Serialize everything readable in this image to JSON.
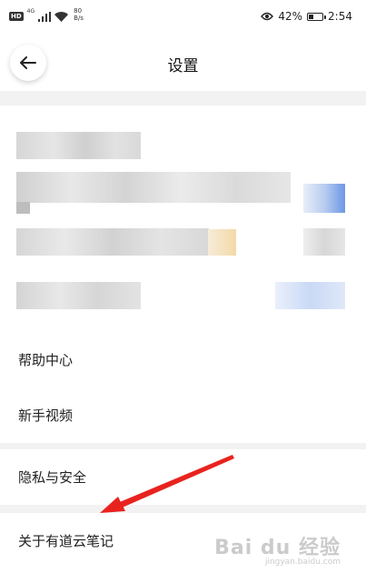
{
  "status_bar": {
    "hd": "HD",
    "signal_text": "4G",
    "net_speed_value": "80",
    "net_speed_unit": "B/s",
    "battery": "42%",
    "time": "2:54"
  },
  "header": {
    "title": "设置"
  },
  "menu": {
    "help": "帮助中心",
    "video": "新手视频",
    "privacy": "隐私与安全",
    "about": "关于有道云笔记"
  },
  "watermark": {
    "main": "Bai du 经验",
    "sub": "jingyan.baidu.com"
  },
  "colors": {
    "accent_arrow": "#e8231f",
    "background": "#f2f2f2"
  },
  "battery_level": 0.42
}
